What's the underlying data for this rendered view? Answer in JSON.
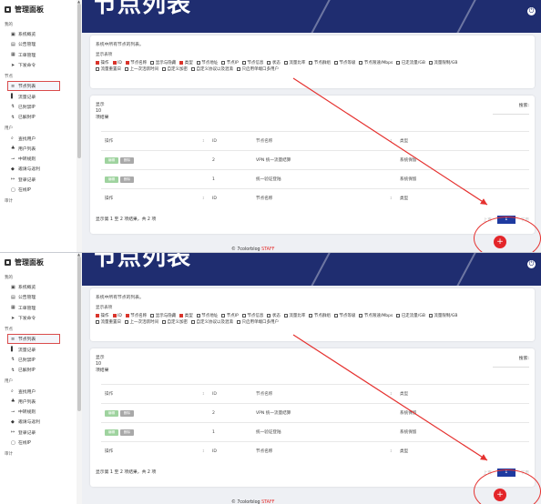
{
  "app": {
    "brand": "管理面板",
    "page_title": "节点列表"
  },
  "sidebar": {
    "section_mine": "我的",
    "mine_items": [
      {
        "icon": "dashboard-icon",
        "glyph": "▣",
        "label": "系统概览"
      },
      {
        "icon": "announce-icon",
        "glyph": "▤",
        "label": "公告管理"
      },
      {
        "icon": "ticket-icon",
        "glyph": "▦",
        "label": "工单管理"
      },
      {
        "icon": "send-icon",
        "glyph": "➤",
        "label": "下发命令"
      }
    ],
    "section_node": "节点",
    "node_items": [
      {
        "icon": "list-icon",
        "glyph": "≡",
        "label": "节点列表",
        "active": true
      },
      {
        "icon": "record-icon",
        "glyph": "▌",
        "label": "流量记录"
      },
      {
        "icon": "ban-icon",
        "glyph": "↯",
        "label": "已封禁IP"
      },
      {
        "icon": "unban-icon",
        "glyph": "↯",
        "label": "已解封IP"
      }
    ],
    "section_user": "用户",
    "user_items": [
      {
        "icon": "search-user-icon",
        "glyph": "⌕",
        "label": "查找用户"
      },
      {
        "icon": "users-icon",
        "glyph": "♣",
        "label": "用户列表"
      },
      {
        "icon": "rule-icon",
        "glyph": "⊸",
        "label": "中转规则"
      },
      {
        "icon": "invite-icon",
        "glyph": "◆",
        "label": "邀请与返利"
      },
      {
        "icon": "login-icon",
        "glyph": "↦",
        "label": "登录记录"
      },
      {
        "icon": "online-icon",
        "glyph": "▢",
        "label": "在线IP"
      }
    ],
    "section_audit": "审计"
  },
  "filter_card": {
    "description": "系统中所有节点的列表。",
    "columns_label": "显示表项",
    "checkboxes": [
      {
        "label": "操作",
        "checked": true
      },
      {
        "label": "ID",
        "checked": true
      },
      {
        "label": "节点名称",
        "checked": true
      },
      {
        "label": "显示与隐藏",
        "checked": false
      },
      {
        "label": "类型",
        "checked": true
      },
      {
        "label": "节点地址",
        "checked": false
      },
      {
        "label": "节点IP",
        "checked": false
      },
      {
        "label": "节点信息",
        "checked": false
      },
      {
        "label": "状态",
        "checked": false
      },
      {
        "label": "流量比率",
        "checked": false
      },
      {
        "label": "节点群组",
        "checked": false
      },
      {
        "label": "节点等级",
        "checked": false
      },
      {
        "label": "节点限速/Mbps",
        "checked": false
      },
      {
        "label": "已走流量/GB",
        "checked": false
      },
      {
        "label": "流量限制/GB",
        "checked": false
      },
      {
        "label": "流量重置日",
        "checked": false
      },
      {
        "label": "上一次活跃时间",
        "checked": false
      },
      {
        "label": "自定义加密",
        "checked": false
      },
      {
        "label": "自定义协议以及混淆",
        "checked": false
      },
      {
        "label": "只启用单端口多用户",
        "checked": false
      }
    ]
  },
  "table_card": {
    "show_label": "显示",
    "page_size": "10",
    "unit_label": "项结果",
    "search_label": "搜索:",
    "columns": [
      "操作",
      "ID",
      "节点名称",
      "类型"
    ],
    "rows": [
      {
        "edit": "编辑",
        "delete": "删除",
        "id": "2",
        "name": "VPN 统一流量结算",
        "type": "系统保留"
      },
      {
        "edit": "编辑",
        "delete": "删除",
        "id": "1",
        "name": "统一验证登陆",
        "type": "系统保留"
      }
    ],
    "summary": "显示第 1 至 2 项结果，共 2 项",
    "prev": "上页",
    "page": "1",
    "next": "下页"
  },
  "fab": {
    "symbol": "+"
  },
  "credit": {
    "prefix": "© 7colorblog",
    "staff": "STAFF"
  },
  "colors": {
    "header": "#1f2d70",
    "accent_red": "#e3262a",
    "pager_blue": "#1e3aa0"
  }
}
